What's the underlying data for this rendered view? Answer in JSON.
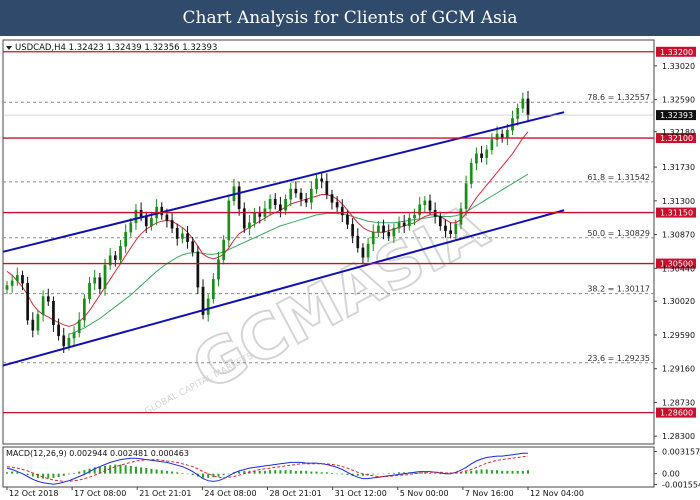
{
  "header": {
    "title": "Chart Analysis for Clients of GCM Asia"
  },
  "instrument": {
    "info": "USDCAD,H4  1.32423  1.32439  1.32356  1.32393"
  },
  "watermark": {
    "text": "GCMASIA",
    "subtext": "GLOBAL CAPITAL MARKETS"
  },
  "colors": {
    "candle_up": "#1a8c1a",
    "candle_down": "#111111",
    "channel": "#1010b0",
    "level_line": "#c8102e",
    "fib_line": "#8a8a8a",
    "ma_fast": "#d42a3a",
    "ma_slow": "#3aa860",
    "macd_main": "#1a2be0",
    "macd_signal": "#d42a3a",
    "macd_hist": "#2aa02a"
  },
  "chart_data": [
    {
      "type": "candlestick",
      "title": "USDCAD,H4  1.32423  1.32439  1.32356  1.32393",
      "ylim": [
        1.282,
        1.3335
      ],
      "y_ticks": [
        "1.33020",
        "1.32590",
        "1.32180",
        "1.31730",
        "1.31300",
        "1.30870",
        "1.30440",
        "1.30020",
        "1.29590",
        "1.29160",
        "1.28730",
        "1.28300"
      ],
      "x_labels": [
        "12 Oct 2018",
        "17 Oct 08:00",
        "21 Oct 21:01",
        "24 Oct 08:00",
        "28 Oct 21:01",
        "31 Oct 12:00",
        "5 Nov 00:00",
        "7 Nov 16:00",
        "12 Nov 04:00"
      ],
      "current_price": "1.32393",
      "levels": [
        {
          "value": 1.332,
          "label": "1.33200"
        },
        {
          "value": 1.321,
          "label": "1.32100"
        },
        {
          "value": 1.3115,
          "label": "1.31150"
        },
        {
          "value": 1.305,
          "label": "1.30500"
        },
        {
          "value": 1.286,
          "label": "1.28600"
        }
      ],
      "fibonacci": [
        {
          "value": 1.32557,
          "label": "78.6 = 1.32557"
        },
        {
          "value": 1.31542,
          "label": "61.8 = 1.31542"
        },
        {
          "value": 1.30829,
          "label": "50.0 = 1.30829"
        },
        {
          "value": 1.30117,
          "label": "38.2 = 1.30117"
        },
        {
          "value": 1.29235,
          "label": "23.6 = 1.29235"
        }
      ],
      "channel": {
        "upper": [
          [
            0,
            1.3065
          ],
          [
            108,
            1.3243
          ]
        ],
        "lower": [
          [
            0,
            1.292
          ],
          [
            108,
            1.3118
          ]
        ]
      },
      "closes": [
        1.3022,
        1.3028,
        1.3035,
        1.3025,
        1.2978,
        1.2965,
        1.2985,
        1.3008,
        1.3002,
        1.2972,
        1.2958,
        1.2945,
        1.2955,
        1.2962,
        1.2978,
        1.3005,
        1.3025,
        1.3032,
        1.3018,
        1.3048,
        1.306,
        1.3055,
        1.3072,
        1.309,
        1.3102,
        1.3118,
        1.311,
        1.3098,
        1.3108,
        1.3122,
        1.3112,
        1.3105,
        1.3095,
        1.3082,
        1.3088,
        1.3078,
        1.3065,
        1.302,
        1.2985,
        1.3005,
        1.303,
        1.3055,
        1.308,
        1.313,
        1.3148,
        1.312,
        1.3095,
        1.3102,
        1.3115,
        1.311,
        1.312,
        1.3132,
        1.3125,
        1.3118,
        1.3132,
        1.3145,
        1.314,
        1.3132,
        1.3128,
        1.3145,
        1.3158,
        1.3155,
        1.3138,
        1.3128,
        1.3122,
        1.3112,
        1.31,
        1.3085,
        1.307,
        1.3058,
        1.3075,
        1.309,
        1.3098,
        1.309,
        1.3085,
        1.3095,
        1.3102,
        1.3098,
        1.3108,
        1.3112,
        1.3125,
        1.313,
        1.3118,
        1.311,
        1.3098,
        1.3092,
        1.3088,
        1.31,
        1.312,
        1.3152,
        1.3178,
        1.319,
        1.3185,
        1.3195,
        1.3208,
        1.3215,
        1.321,
        1.322,
        1.3235,
        1.3248,
        1.326,
        1.3239
      ],
      "ma_fast": [
        1.304,
        1.3035,
        1.3028,
        1.302,
        1.301,
        1.2998,
        1.299,
        1.2985,
        1.2982,
        1.2978,
        1.2975,
        1.2972,
        1.297,
        1.2972,
        1.2976,
        1.2982,
        1.299,
        1.3,
        1.301,
        1.302,
        1.303,
        1.304,
        1.305,
        1.306,
        1.307,
        1.308,
        1.3088,
        1.3094,
        1.3098,
        1.3102,
        1.3104,
        1.3105,
        1.3104,
        1.31,
        1.3096,
        1.309,
        1.3082,
        1.3072,
        1.3062,
        1.3058,
        1.3056,
        1.3058,
        1.3062,
        1.307,
        1.308,
        1.3088,
        1.3092,
        1.3096,
        1.31,
        1.3104,
        1.3108,
        1.3112,
        1.3115,
        1.3118,
        1.3122,
        1.3126,
        1.3128,
        1.313,
        1.3132,
        1.3134,
        1.3136,
        1.3138,
        1.3138,
        1.3136,
        1.3132,
        1.3126,
        1.3118,
        1.311,
        1.3102,
        1.3096,
        1.3092,
        1.309,
        1.309,
        1.309,
        1.3092,
        1.3094,
        1.3096,
        1.3098,
        1.31,
        1.3102,
        1.3106,
        1.311,
        1.3112,
        1.3112,
        1.311,
        1.3106,
        1.3102,
        1.3102,
        1.3106,
        1.3114,
        1.3124,
        1.3134,
        1.3142,
        1.315,
        1.3158,
        1.3166,
        1.3174,
        1.3182,
        1.319,
        1.32,
        1.321,
        1.3218
      ],
      "ma_slow": [
        null,
        null,
        null,
        null,
        null,
        null,
        null,
        null,
        null,
        null,
        null,
        null,
        1.296,
        1.2962,
        1.2965,
        1.2968,
        1.2972,
        1.2976,
        1.298,
        1.2985,
        1.299,
        1.2995,
        1.3,
        1.3005,
        1.301,
        1.3016,
        1.3022,
        1.3028,
        1.3034,
        1.304,
        1.3045,
        1.305,
        1.3054,
        1.3058,
        1.3061,
        1.3063,
        1.3064,
        1.3064,
        1.3063,
        1.3062,
        1.3062,
        1.3063,
        1.3065,
        1.3068,
        1.3071,
        1.3074,
        1.3077,
        1.308,
        1.3083,
        1.3086,
        1.3089,
        1.3092,
        1.3095,
        1.3098,
        1.31,
        1.3102,
        1.3104,
        1.3106,
        1.3108,
        1.311,
        1.3112,
        1.3113,
        1.3114,
        1.3114,
        1.3114,
        1.3113,
        1.3112,
        1.311,
        1.3108,
        1.3106,
        1.3104,
        1.3103,
        1.3102,
        1.3102,
        1.3102,
        1.3102,
        1.3103,
        1.3104,
        1.3105,
        1.3106,
        1.3107,
        1.3108,
        1.3109,
        1.311,
        1.311,
        1.311,
        1.311,
        1.3111,
        1.3113,
        1.3116,
        1.312,
        1.3124,
        1.3128,
        1.3132,
        1.3136,
        1.314,
        1.3144,
        1.3148,
        1.3152,
        1.3156,
        1.316,
        1.3164
      ]
    },
    {
      "type": "macd",
      "title": "MACD(12,26,9) 0.002944 0.002481 0.000463",
      "ylim": [
        -0.0019,
        0.0038
      ],
      "y_ticks": [
        "0.003157",
        "0.00",
        "-0.001554"
      ],
      "main": [
        0.0008,
        0.0006,
        0.0003,
        0.0,
        -0.0004,
        -0.0008,
        -0.0011,
        -0.0013,
        -0.0014,
        -0.0015,
        -0.0014,
        -0.0012,
        -0.001,
        -0.0007,
        -0.0004,
        -0.0001,
        0.0003,
        0.0007,
        0.001,
        0.0013,
        0.0016,
        0.0018,
        0.002,
        0.0021,
        0.0022,
        0.0022,
        0.0021,
        0.002,
        0.0019,
        0.0018,
        0.0017,
        0.0016,
        0.0014,
        0.0012,
        0.001,
        0.0007,
        0.0003,
        -0.0002,
        -0.0007,
        -0.001,
        -0.0011,
        -0.001,
        -0.0007,
        -0.0003,
        0.0001,
        0.0004,
        0.0006,
        0.0008,
        0.0009,
        0.001,
        0.0011,
        0.0012,
        0.0013,
        0.0014,
        0.0015,
        0.0016,
        0.0016,
        0.0016,
        0.0015,
        0.0015,
        0.0015,
        0.0014,
        0.0013,
        0.0011,
        0.0009,
        0.0006,
        0.0002,
        -0.0002,
        -0.0005,
        -0.0007,
        -0.0007,
        -0.0006,
        -0.0005,
        -0.0004,
        -0.0003,
        -0.0002,
        -0.0001,
        0.0,
        0.0001,
        0.0002,
        0.0003,
        0.0003,
        0.0003,
        0.0002,
        0.0001,
        0.0,
        0.0,
        0.0002,
        0.0005,
        0.0009,
        0.0014,
        0.0018,
        0.0021,
        0.0023,
        0.0024,
        0.0025,
        0.0025,
        0.0026,
        0.0027,
        0.0028,
        0.0029,
        0.0029
      ],
      "signal": [
        0.001,
        0.0009,
        0.0008,
        0.0006,
        0.0004,
        0.0001,
        -0.0002,
        -0.0005,
        -0.0007,
        -0.0009,
        -0.001,
        -0.0011,
        -0.0011,
        -0.001,
        -0.0009,
        -0.0007,
        -0.0005,
        -0.0002,
        0.0001,
        0.0004,
        0.0007,
        0.001,
        0.0012,
        0.0014,
        0.0016,
        0.0018,
        0.0019,
        0.002,
        0.002,
        0.002,
        0.0019,
        0.0018,
        0.0017,
        0.0016,
        0.0014,
        0.0012,
        0.001,
        0.0007,
        0.0003,
        0.0,
        -0.0003,
        -0.0005,
        -0.0006,
        -0.0005,
        -0.0004,
        -0.0002,
        0.0,
        0.0002,
        0.0004,
        0.0006,
        0.0007,
        0.0008,
        0.0009,
        0.001,
        0.0011,
        0.0012,
        0.0013,
        0.0014,
        0.0014,
        0.0014,
        0.0014,
        0.0014,
        0.0014,
        0.0013,
        0.0012,
        0.001,
        0.0008,
        0.0005,
        0.0002,
        0.0,
        -0.0002,
        -0.0003,
        -0.0004,
        -0.0004,
        -0.0004,
        -0.0003,
        -0.0002,
        -0.0002,
        -0.0001,
        0.0,
        0.0001,
        0.0001,
        0.0002,
        0.0002,
        0.0002,
        0.0001,
        0.0001,
        0.0001,
        0.0002,
        0.0004,
        0.0006,
        0.0009,
        0.0012,
        0.0015,
        0.0017,
        0.0019,
        0.002,
        0.0021,
        0.0022,
        0.0023,
        0.0024,
        0.0025
      ],
      "histogram": [
        0.0002,
        0.0003,
        0.0002,
        0.0,
        -0.0002,
        -0.0004,
        -0.0006,
        -0.0007,
        -0.0007,
        -0.0006,
        -0.0005,
        -0.0003,
        -0.0001,
        0.0001,
        0.0003,
        0.0005,
        0.0007,
        0.0009,
        0.001,
        0.0011,
        0.0012,
        0.0013,
        0.0013,
        0.0012,
        0.0011,
        0.001,
        0.0009,
        0.0008,
        0.0007,
        0.0006,
        0.0005,
        0.0004,
        0.0003,
        0.0002,
        0.0001,
        0.0,
        -0.0002,
        -0.0004,
        -0.0006,
        -0.0006,
        -0.0005,
        -0.0004,
        -0.0002,
        0.0,
        0.0002,
        0.0003,
        0.0004,
        0.0004,
        0.0004,
        0.0004,
        0.0004,
        0.0005,
        0.0005,
        0.0005,
        0.0005,
        0.0005,
        0.0004,
        0.0004,
        0.0004,
        0.0003,
        0.0003,
        0.0002,
        0.0002,
        0.0001,
        0.0,
        -0.0001,
        -0.0002,
        -0.0003,
        -0.0003,
        -0.0003,
        -0.0002,
        -0.0001,
        0.0,
        0.0,
        0.0001,
        0.0001,
        0.0002,
        0.0002,
        0.0002,
        0.0002,
        0.0002,
        0.0002,
        0.0001,
        0.0001,
        0.0,
        0.0,
        0.0,
        0.0001,
        0.0002,
        0.0003,
        0.0004,
        0.0005,
        0.0006,
        0.0006,
        0.0005,
        0.0005,
        0.0004,
        0.0004,
        0.0004,
        0.0004,
        0.0004,
        0.0005
      ]
    }
  ]
}
